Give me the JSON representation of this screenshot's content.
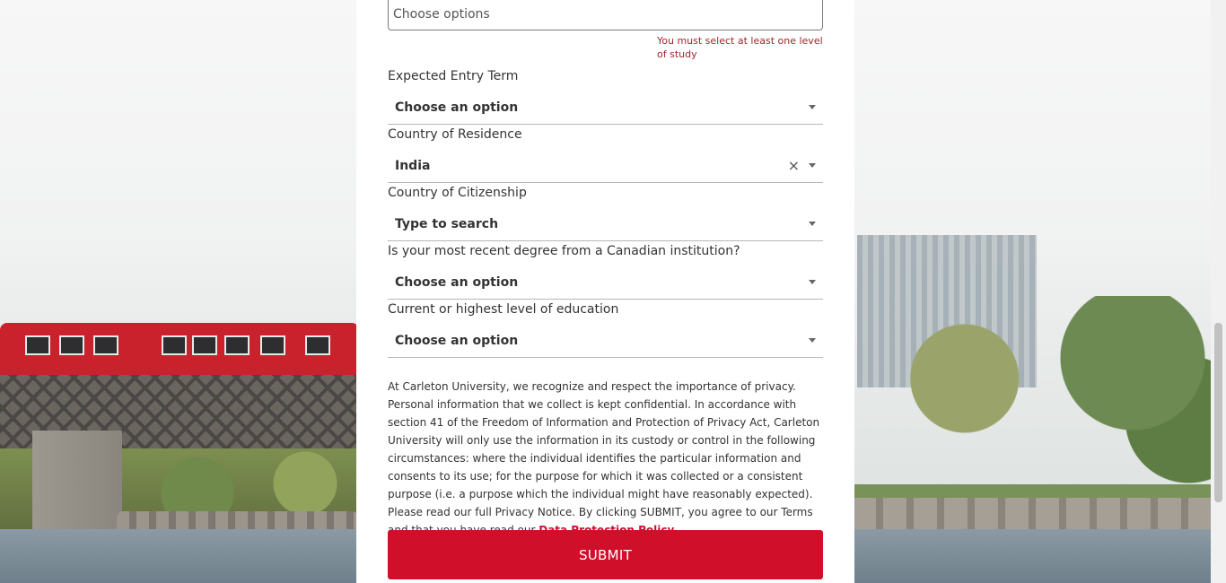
{
  "form": {
    "level_of_study": {
      "placeholder": "Choose options",
      "error": "You must select at least one level of study"
    },
    "fields": [
      {
        "label": "Expected Entry Term",
        "value": "Choose an option"
      },
      {
        "label": "Country of Residence",
        "value": "India",
        "clear": "×"
      },
      {
        "label": "Country of Citizenship",
        "value": "Type to search"
      },
      {
        "label": "Is your most recent degree from a Canadian institution?",
        "value": "Choose an option"
      },
      {
        "label": "Current or highest level of education",
        "value": "Choose an option"
      }
    ],
    "privacy_text": "At Carleton University, we recognize and respect the importance of privacy. Personal information that we collect is kept confidential. In accordance with section 41 of the Freedom of Information and Protection of Privacy Act, Carleton University will only use the information in its custody or control in the following circumstances: where the individual identifies the particular information and consents to its use; for the purpose for which it was collected or a consistent purpose (i.e. a purpose which the individual might have reasonably expected). Please read our full Privacy Notice. By clicking SUBMIT, you agree to our Terms and that you have read our ",
    "privacy_link": "Data Protection Policy",
    "privacy_end": ".",
    "submit_label": "SUBMIT"
  },
  "colors": {
    "accent": "#d0102b",
    "error": "#a1262c"
  }
}
